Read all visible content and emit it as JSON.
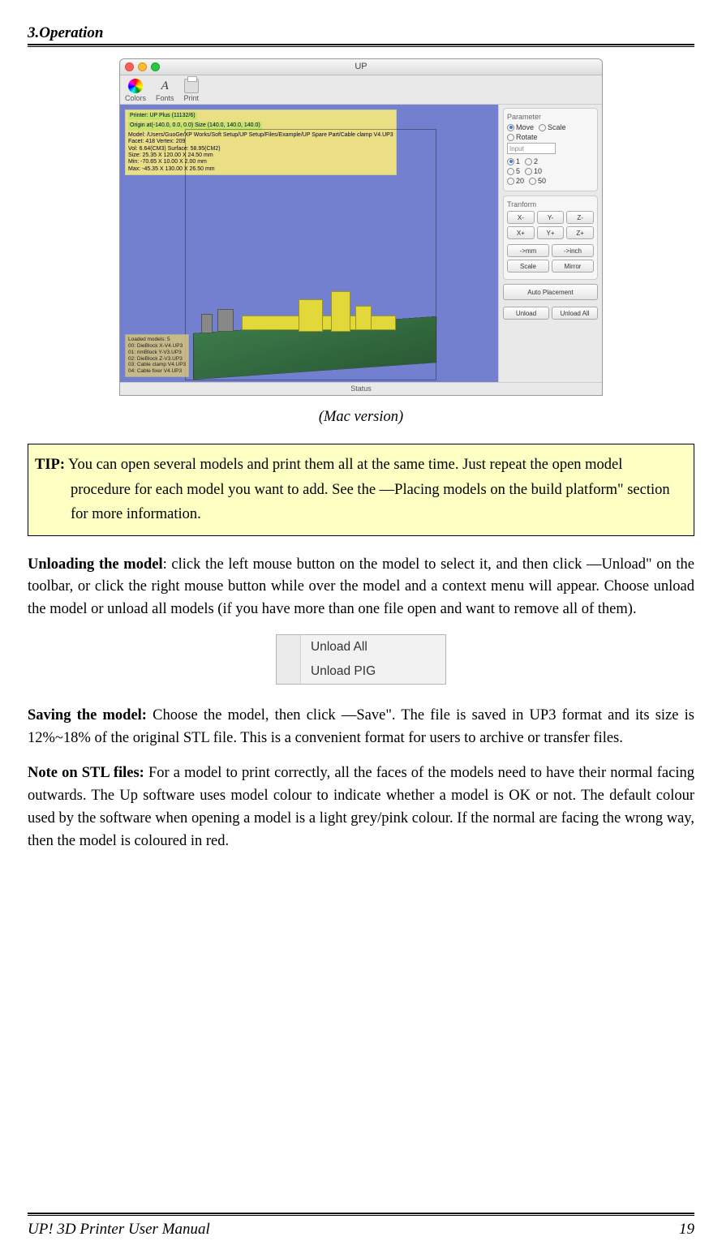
{
  "header": {
    "section": "3.Operation"
  },
  "screenshot": {
    "window_title": "UP",
    "toolbar": {
      "colors": "Colors",
      "fonts": "Fonts",
      "print": "Print",
      "fonts_glyph": "A"
    },
    "info": {
      "printer_line": "Printer: UP Plus (11132/6)",
      "origin_line": "Origin at(-140.0, 0.0, 0.0)   Size (140.0, 140.0, 140.0)",
      "model_line": "Model: /Users/GuoGe/XP Works/Soft Setup/UP Setup/Files/Example/UP Spare Part/Cable clamp V4.UP3",
      "facet_line": "Facet: 418   Vertex: 209",
      "vol_line": "Vol: 6.64(CM3)   Surface: 58.95(CM2)",
      "size_line": "Size: 25.35 X 120.00 X 24.50 mm",
      "min_line": "Min: -70.65 X 10.00 X 2.00 mm",
      "max_line": "Max: -45.35 X 130.00 X 26.50 mm"
    },
    "loaded": {
      "title": "Loaded models: 5",
      "l0": "00: DieBlock X-V4.UP3",
      "l1": "01: rimBlock Y-V3.UP3",
      "l2": "02: DieBlock Z-V3.UP3",
      "l3": "03: Cable clamp V4.UP3",
      "l4": "04: Cable fixer V4.UP3"
    },
    "panel": {
      "parameter": "Parameter",
      "move": "Move",
      "scale": "Scale",
      "rotate": "Rotate",
      "input_placeholder": "Input",
      "n1": "1",
      "n2": "2",
      "n5": "5",
      "n10": "10",
      "n20": "20",
      "n50": "50",
      "transform": "Tranform",
      "xm": "X-",
      "ym": "Y-",
      "zm": "Z-",
      "xp": "X+",
      "yp": "Y+",
      "zp": "Z+",
      "tomm": "->mm",
      "toinch": "->inch",
      "scale_btn": "Scale",
      "mirror_btn": "Mirror",
      "auto": "Auto Placement",
      "unload": "Unload",
      "unload_all": "Unload All"
    },
    "status": "Status"
  },
  "caption": "(Mac version)",
  "tip": {
    "label": "TIP:",
    "text": " You can open several models and print them all at the same time. Just repeat the open model procedure for each model you want to add. See the ―Placing models on the build platform\" section for more information."
  },
  "para_unload": {
    "label": "Unloading the model",
    "text": ": click the left mouse button on the model to select it, and then click ―Unload\" on the toolbar, or click the right mouse button while over the model and a context menu will appear. Choose unload the model or unload all models (if you have more than one file open and want to remove all of them)."
  },
  "context_menu": {
    "item1": "Unload All",
    "item2": "Unload PIG"
  },
  "para_save": {
    "label": "Saving the model:",
    "text": " Choose the model, then click ―Save\". The file is saved in UP3 format and its size is 12%~18% of the original STL file. This is a convenient format for users to archive or transfer files."
  },
  "para_stl": {
    "label": "Note on STL files:",
    "text": " For a model to print correctly, all the faces of the models need to have their normal facing outwards. The Up software uses model colour to indicate whether a model is OK or not. The default colour used by the software when opening a model is a light grey/pink colour. If the normal are facing the wrong way, then the model is coloured in red."
  },
  "footer": {
    "left": "UP! 3D Printer User Manual",
    "right": "19"
  }
}
